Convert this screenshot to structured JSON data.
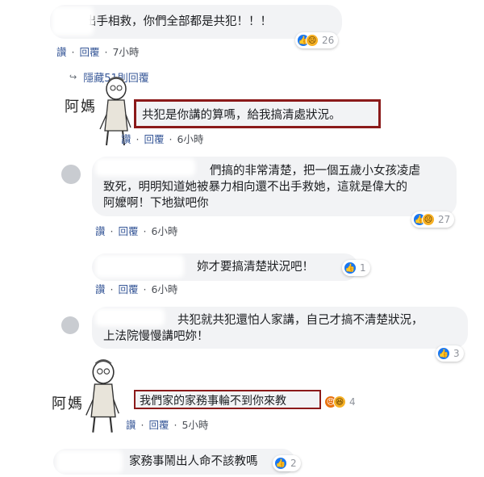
{
  "comments": [
    {
      "text": "：不出手相救，你們全部都是共犯！！！",
      "reactions": "26",
      "actions": [
        "讚",
        "回覆",
        "7小時"
      ]
    },
    {
      "text": "共犯是你講的算嗎，給我搞清處狀況。",
      "reactions": "",
      "actions": [
        "讚",
        "回覆",
        "6小時"
      ]
    },
    {
      "text_lines": [
        "們搞的非常清楚，把一個五歲小女孩凌虐",
        "致死，明明知道她被暴力相向還不出手救她，這就是偉大的",
        "阿嬤啊！下地獄吧你"
      ],
      "reactions": "27",
      "actions": [
        "讚",
        "回覆",
        "6小時"
      ]
    },
    {
      "text": "妳才要搞清楚狀況吧！",
      "reactions": "1",
      "actions": [
        "讚",
        "回覆",
        "6小時"
      ]
    },
    {
      "text_lines": [
        "共犯就共犯還怕人家講，自己才搞不清楚狀況，",
        "上法院慢慢講吧妳！"
      ],
      "reactions": "3",
      "actions": []
    },
    {
      "text": "我們家的家務事輪不到你來教",
      "reactions": "4",
      "actions": [
        "讚",
        "回覆",
        "5小時"
      ]
    },
    {
      "text": "家務事鬧出人命不該教嗎",
      "reactions": "2",
      "actions": []
    }
  ],
  "hidden_replies": "隱藏51則回覆",
  "mama_label": "阿媽",
  "separator": "·",
  "icons": {
    "like": "like-icon",
    "sad": "sad-icon",
    "angry": "angry-icon",
    "haha": "haha-icon"
  },
  "colors": {
    "bubble": "#f2f3f5",
    "highlight_box": "#8b1a1a",
    "link": "#385898",
    "like": "#1877f2"
  }
}
